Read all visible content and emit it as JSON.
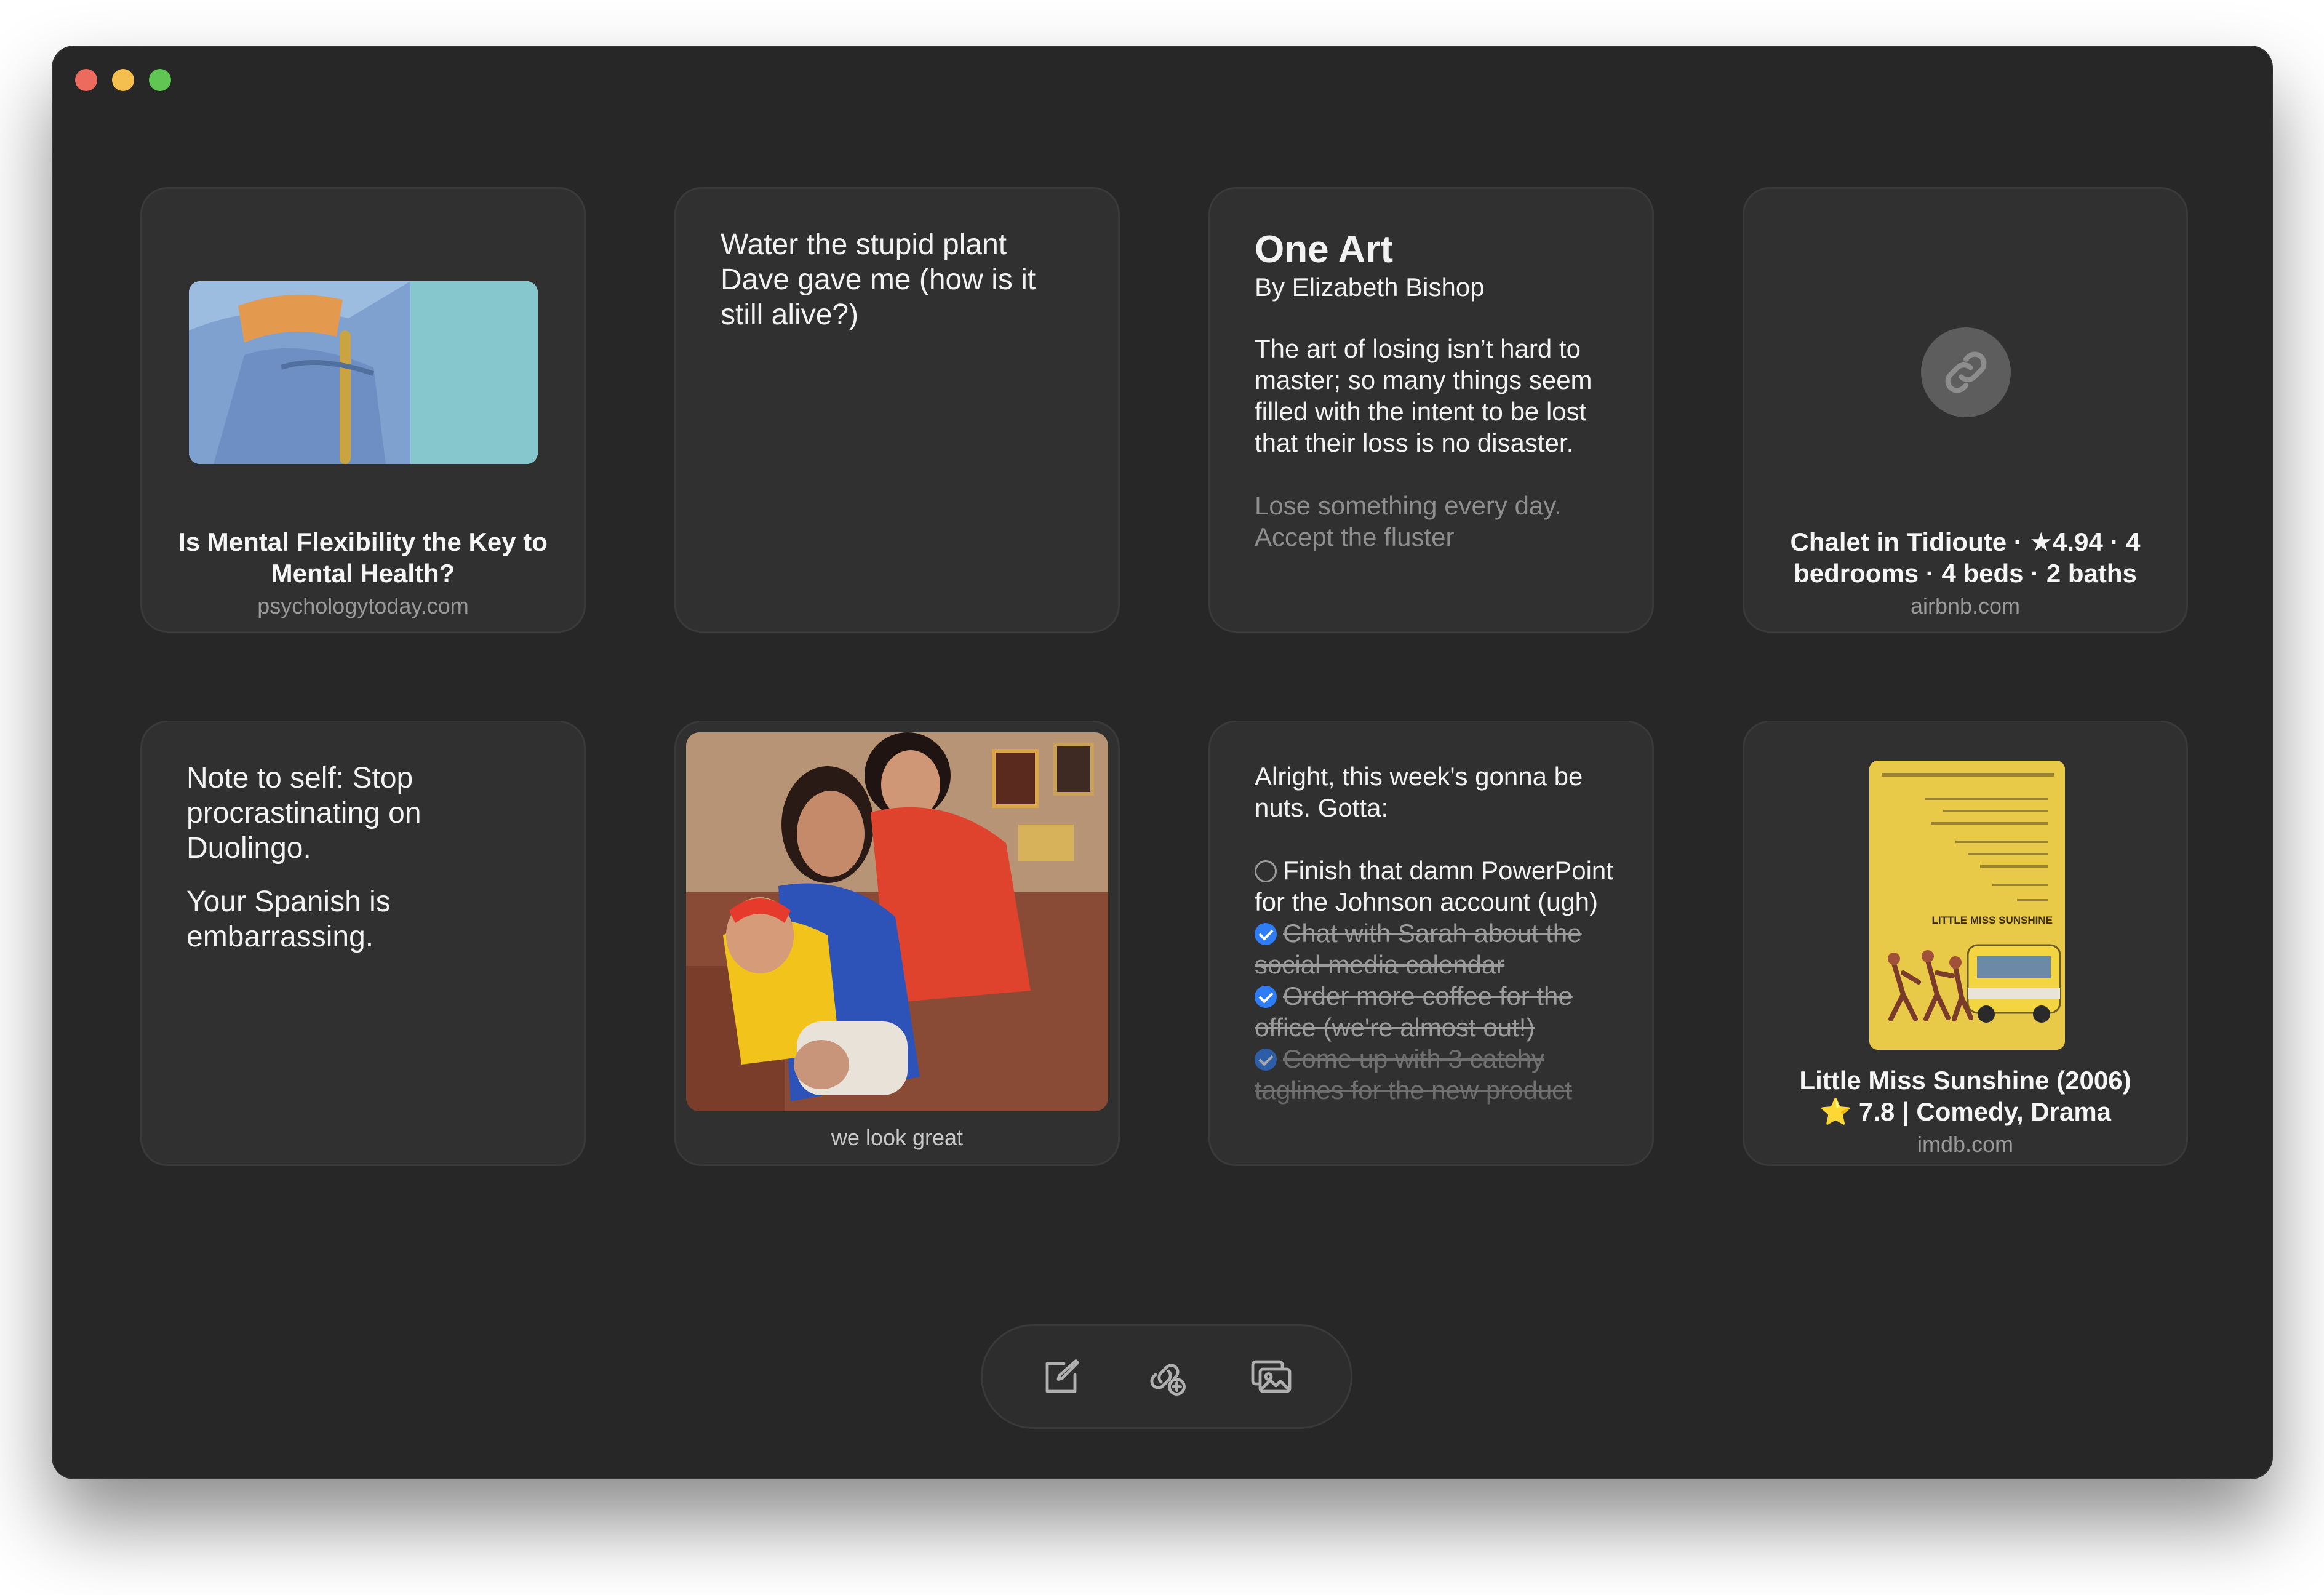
{
  "window": {
    "title": ""
  },
  "cards": {
    "article": {
      "title": "Is Mental Flexibility the Key to Mental Health?",
      "domain": "psychologytoday.com"
    },
    "note_plant": {
      "text": "Water the stupid plant Dave gave me (how is it still alive?)"
    },
    "poem": {
      "title": "One Art",
      "author": "By Elizabeth Bishop",
      "stanza1": "The art of losing isn’t hard to master; so many things seem filled with the intent to be lost that their loss is no disaster.",
      "stanza2": "Lose something every day. Accept the fluster"
    },
    "airbnb": {
      "title": "Chalet in Tidioute · ★4.94 · 4 bedrooms · 4 beds · 2 baths",
      "domain": "airbnb.com"
    },
    "note_duolingo": {
      "para1": "Note to self: Stop procrastinating on Duolingo.",
      "para2": "Your Spanish is embarrassing."
    },
    "photo": {
      "caption": "we look great"
    },
    "todo": {
      "intro": "Alright, this week's gonna be nuts. Gotta:",
      "items": [
        {
          "text": "Finish that damn PowerPoint for the Johnson account (ugh)",
          "done": false
        },
        {
          "text": "Chat with Sarah about the social media calendar",
          "done": true
        },
        {
          "text": "Order more coffee for the office (we're almost out!)",
          "done": true
        },
        {
          "text": "Come up with 3 catchy taglines for the new product",
          "done": true
        }
      ]
    },
    "movie": {
      "title": "Little Miss Sunshine (2006)",
      "rating": "⭐ 7.8 | Comedy, Drama",
      "domain": "imdb.com",
      "poster_title": "LITTLE MISS SUNSHINE"
    }
  },
  "toolbar": {
    "icons": [
      "compose-icon",
      "add-link-icon",
      "add-image-icon"
    ]
  },
  "colors": {
    "background": "#272727",
    "card": "#303030",
    "accent": "#2e7cf6"
  }
}
